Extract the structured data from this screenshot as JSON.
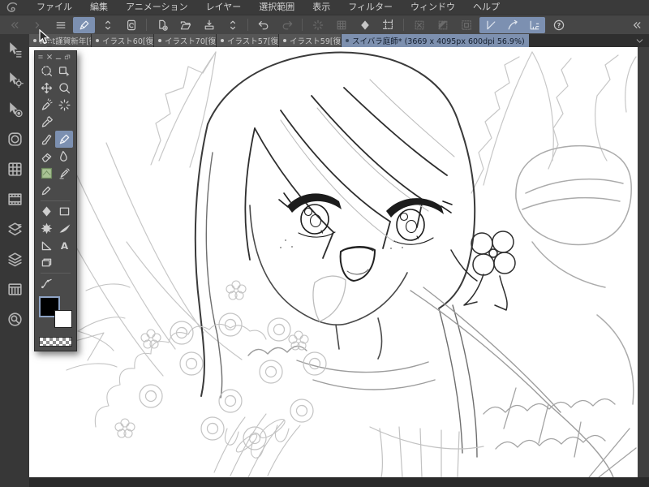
{
  "app": {
    "name_icon": "clip-studio-logo"
  },
  "menu_bar": {
    "items": [
      "ファイル",
      "編集",
      "アニメーション",
      "レイヤー",
      "選択範囲",
      "表示",
      "フィルター",
      "ウィンドウ",
      "ヘルプ"
    ]
  },
  "toolbar": {
    "items": [
      {
        "name": "scroll-left-button",
        "icon": "nav-left",
        "state": "disabled"
      },
      {
        "name": "scroll-right-button",
        "icon": "nav-right",
        "state": "disabled"
      },
      {
        "name": "main-menu-button",
        "icon": "hamburger",
        "state": "normal"
      },
      {
        "name": "current-tool-button",
        "icon": "pen",
        "state": "active"
      },
      {
        "name": "tool-switch-stepper",
        "icon": "updown",
        "state": "normal"
      },
      {
        "name": "clip-studio-button",
        "icon": "clipstudio",
        "state": "normal"
      },
      {
        "sep": true
      },
      {
        "name": "new-file-button",
        "icon": "new-file",
        "state": "normal"
      },
      {
        "name": "open-file-button",
        "icon": "open-folder",
        "state": "normal"
      },
      {
        "name": "save-file-button",
        "icon": "save",
        "state": "normal"
      },
      {
        "name": "save-switch-stepper",
        "icon": "updown",
        "state": "normal"
      },
      {
        "sep": true
      },
      {
        "name": "undo-button",
        "icon": "undo",
        "state": "normal"
      },
      {
        "name": "redo-button",
        "icon": "redo",
        "state": "disabled"
      },
      {
        "sep": true
      },
      {
        "name": "sync-spinner",
        "icon": "spinner",
        "state": "disabled"
      },
      {
        "name": "register-material-button",
        "icon": "material-grid",
        "state": "disabled"
      },
      {
        "name": "clear-button",
        "icon": "diamond",
        "state": "normal"
      },
      {
        "name": "crop-canvas-button",
        "icon": "crop",
        "state": "normal"
      },
      {
        "sep": true
      },
      {
        "name": "deselect-button",
        "icon": "deselect",
        "state": "disabled"
      },
      {
        "name": "invert-selection-button",
        "icon": "invert-selection",
        "state": "disabled"
      },
      {
        "name": "selection-border-button",
        "icon": "selection-border",
        "state": "disabled"
      },
      {
        "group": [
          {
            "name": "snap-to-ruler-toggle",
            "icon": "snap-ruler"
          },
          {
            "name": "snap-to-special-ruler-toggle",
            "icon": "snap-special"
          },
          {
            "name": "snap-to-grid-toggle",
            "icon": "snap-grid"
          }
        ]
      },
      {
        "name": "help-button",
        "icon": "help",
        "state": "normal"
      },
      {
        "spacer": true
      },
      {
        "name": "collapse-toolbar-button",
        "icon": "nav-left",
        "state": "normal"
      }
    ]
  },
  "tab_bar": {
    "tabs": [
      {
        "label": "Kmt謹賀新年[復",
        "modified": true,
        "active": false
      },
      {
        "label": "イラスト60[復",
        "modified": true,
        "active": false
      },
      {
        "label": "イラスト70[復",
        "modified": true,
        "active": false
      },
      {
        "label": "イラスト57[復",
        "modified": true,
        "active": false
      },
      {
        "label": "イラスト59[復",
        "modified": true,
        "active": false
      },
      {
        "label": "スイバラ庭師* (3669 x 4095px 600dpi 56.9%)",
        "modified": true,
        "active": true
      }
    ],
    "overflow_icon": "chevron-down-icon"
  },
  "left_dock": {
    "items": [
      {
        "name": "tool-palette-button",
        "icon": "cursor-menu"
      },
      {
        "name": "sub-tool-palette-button",
        "icon": "cursor-gear"
      },
      {
        "name": "tool-property-palette-button",
        "icon": "cursor-target"
      },
      {
        "name": "color-wheel-palette-button",
        "icon": "color-wheel"
      },
      {
        "name": "color-set-palette-button",
        "icon": "color-set"
      },
      {
        "name": "timeline-palette-button",
        "icon": "filmstrip"
      },
      {
        "name": "layer-property-palette-button",
        "icon": "layer-property"
      },
      {
        "name": "layer-palette-button",
        "icon": "layers"
      },
      {
        "name": "material-palette-button",
        "icon": "table-grid"
      },
      {
        "name": "navigator-palette-button",
        "icon": "navigator"
      }
    ]
  },
  "tool_palette": {
    "header_icons": [
      {
        "name": "palette-menu-icon",
        "icon": "hamburger"
      },
      {
        "name": "palette-close-icon",
        "icon": "close"
      },
      {
        "name": "palette-minimize-icon",
        "icon": "minimize"
      },
      {
        "name": "palette-dock-icon",
        "icon": "dock-window"
      }
    ],
    "rows": [
      [
        {
          "name": "selection-tool",
          "icon": "sel-lasso"
        },
        {
          "name": "object-tool",
          "icon": "object"
        }
      ],
      [
        {
          "name": "move-tool",
          "icon": "move"
        },
        {
          "name": "zoom-tool",
          "icon": "magnifier"
        }
      ],
      [
        {
          "name": "operation-tool",
          "icon": "op-pen"
        },
        {
          "name": "auto-select-tool",
          "icon": "wand"
        }
      ],
      [
        {
          "name": "eyedropper-tool",
          "icon": "eyedropper"
        },
        null
      ],
      [
        {
          "name": "brush-tool",
          "icon": "ink-brush"
        },
        {
          "name": "pen-tool",
          "icon": "pen",
          "selected": true
        }
      ],
      [
        {
          "name": "eraser-tool",
          "icon": "eraser"
        },
        {
          "name": "blend-tool",
          "icon": "blend"
        }
      ],
      [
        {
          "name": "decoration-tool",
          "icon": "decoration"
        },
        {
          "name": "airbrush-tool",
          "icon": "airbrush"
        }
      ],
      [
        {
          "name": "marker-tool",
          "icon": "marker"
        },
        null
      ],
      "sep",
      [
        {
          "name": "fill-tool",
          "icon": "diamond"
        },
        {
          "name": "frame-tool",
          "icon": "frame-rect"
        }
      ],
      [
        {
          "name": "flash-tool",
          "icon": "flash"
        },
        {
          "name": "stream-line-tool",
          "icon": "swoosh"
        }
      ],
      [
        {
          "name": "figure-tool",
          "icon": "figure"
        },
        {
          "name": "text-tool",
          "icon": "text"
        }
      ],
      [
        {
          "name": "frame-border-tool",
          "icon": "panels"
        },
        null
      ],
      "sep",
      [
        {
          "name": "correct-line-tool",
          "icon": "correct-line"
        },
        null
      ]
    ],
    "colors": {
      "foreground": "#000000",
      "background": "#ffffff",
      "transparent_chip": "checkerboard"
    }
  }
}
